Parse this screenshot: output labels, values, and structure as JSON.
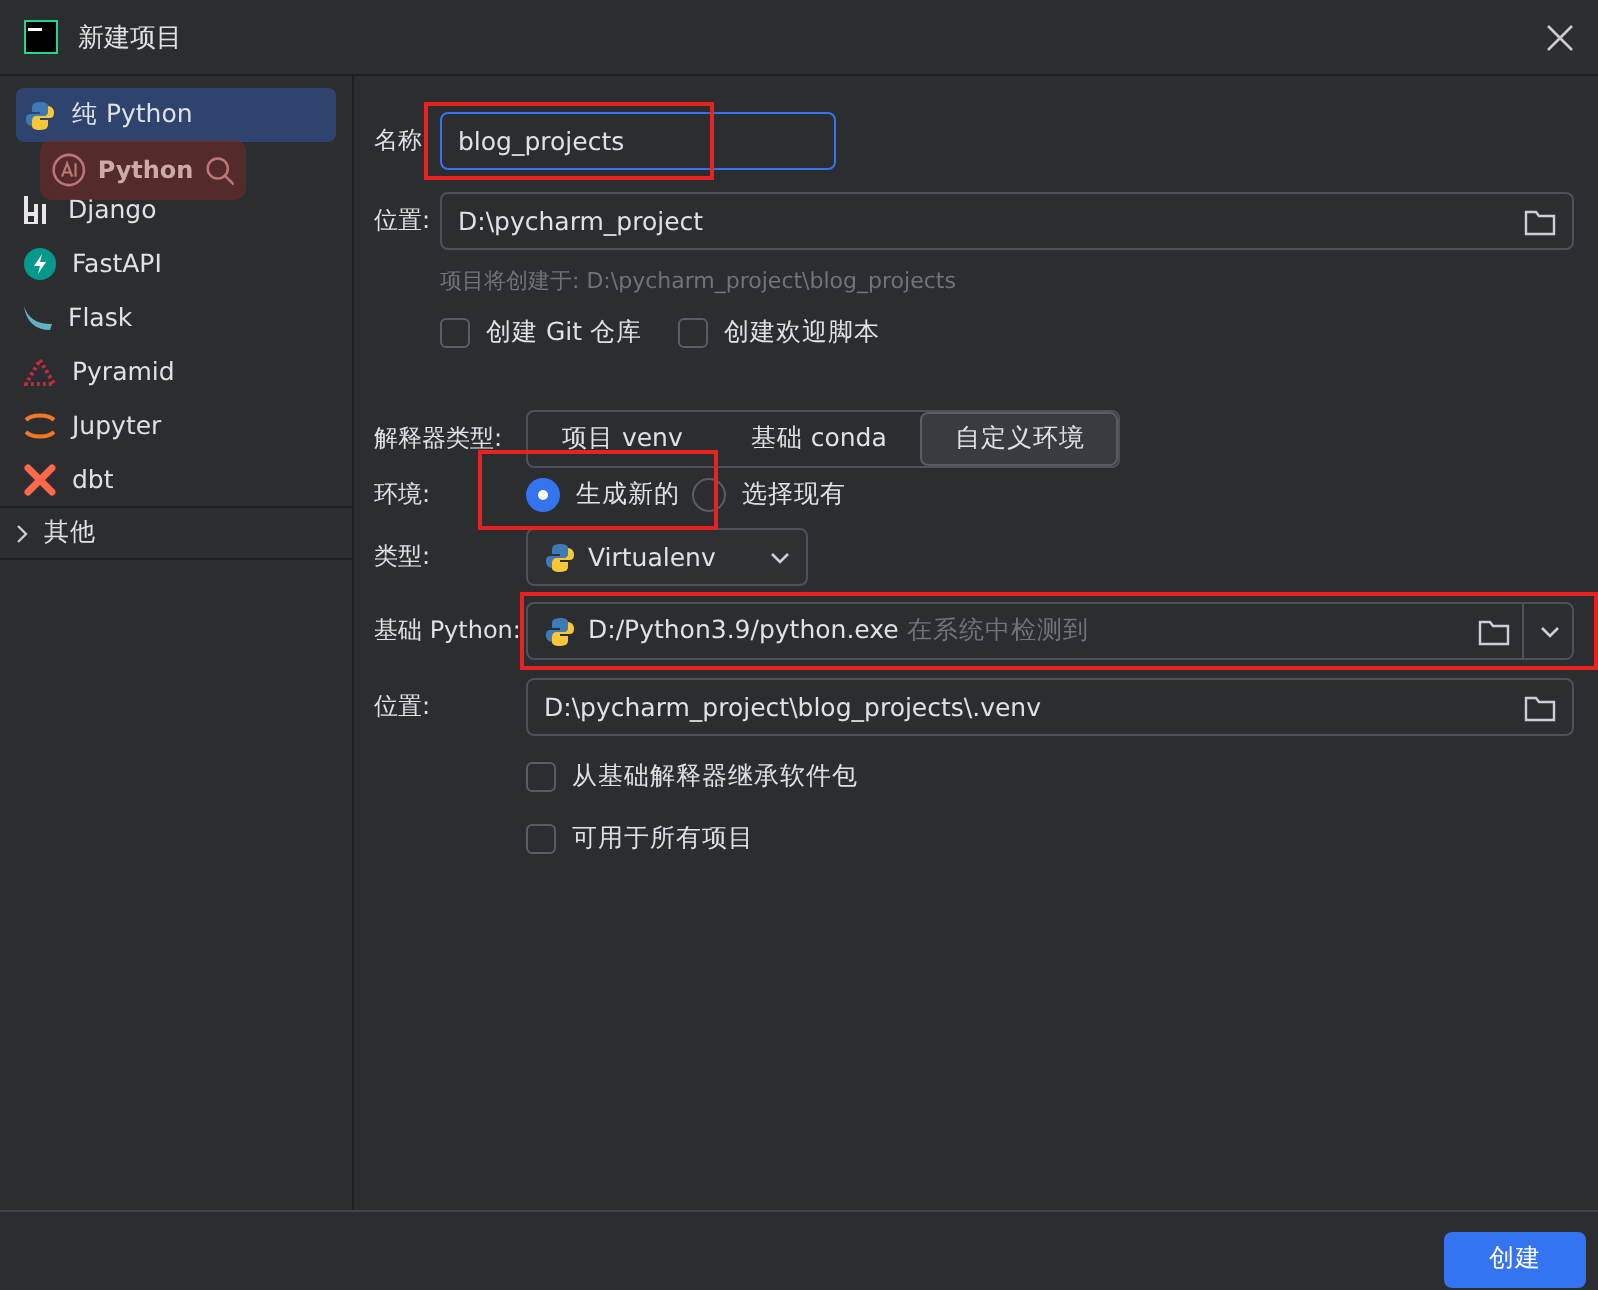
{
  "window": {
    "title": "新建项目"
  },
  "sidebar": {
    "items": [
      {
        "label": "纯 Python",
        "kind": "python",
        "selected": true
      },
      {
        "label": "Django",
        "kind": "django",
        "selected": false
      },
      {
        "label": "FastAPI",
        "kind": "fastapi",
        "selected": false
      },
      {
        "label": "Flask",
        "kind": "flask",
        "selected": false
      },
      {
        "label": "Pyramid",
        "kind": "pyramid",
        "selected": false
      },
      {
        "label": "Jupyter",
        "kind": "jupyter",
        "selected": false
      },
      {
        "label": "dbt",
        "kind": "dbt",
        "selected": false
      }
    ],
    "group": {
      "label": "其他",
      "expanded": false
    }
  },
  "overlay_toolbar": {
    "label": "Python"
  },
  "form": {
    "name": {
      "label": "名称",
      "value": "blog_projects",
      "highlighted": true
    },
    "location": {
      "label": "位置:",
      "value": "D:\\pycharm_project"
    },
    "hint": "项目将创建于: D:\\pycharm_project\\blog_projects",
    "options": [
      {
        "label": "创建 Git 仓库",
        "checked": false
      },
      {
        "label": "创建欢迎脚本",
        "checked": false
      }
    ],
    "interpreter_type": {
      "label": "解释器类型:",
      "tabs": [
        {
          "label": "项目 venv",
          "selected": false
        },
        {
          "label": "基础 conda",
          "selected": false
        },
        {
          "label": "自定义环境",
          "selected": true
        }
      ]
    },
    "environment": {
      "label": "环境:",
      "highlighted": true,
      "choices": [
        {
          "label": "生成新的",
          "selected": true
        },
        {
          "label": "选择现有",
          "selected": false
        }
      ]
    },
    "type": {
      "label": "类型:",
      "value": "Virtualenv"
    },
    "base_python": {
      "label": "基础 Python:",
      "value": "D:/Python3.9/python.exe",
      "note": "在系统中检测到",
      "highlighted": true
    },
    "env_location": {
      "label": "位置:",
      "value": "D:\\pycharm_project\\blog_projects\\.venv"
    },
    "env_options": [
      {
        "label": "从基础解释器继承软件包",
        "checked": false
      },
      {
        "label": "可用于所有项目",
        "checked": false
      }
    ]
  },
  "buttons": [
    {
      "label": "创建",
      "kind": "primary"
    }
  ]
}
